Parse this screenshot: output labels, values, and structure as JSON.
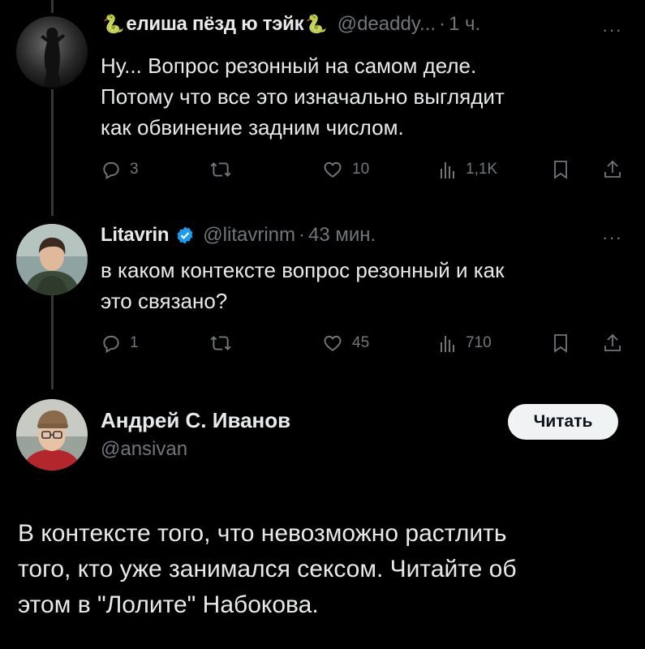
{
  "tweets": [
    {
      "name_before": "елиша пёзд ю тэйк",
      "snake_emoji": "🐍",
      "handle": "@deaddy...",
      "time": "1 ч.",
      "text_lines": [
        "Ну... Вопрос резонный на самом деле.",
        "Потому что все это изначально выглядит",
        "как обвинение задним числом."
      ],
      "replies": "3",
      "retweets": "",
      "likes": "10",
      "views": "1,1K"
    },
    {
      "name": "Litavrin",
      "handle": "@litavrinm",
      "time": "43 мин.",
      "text_lines": [
        "в каком контексте вопрос резонный и как",
        "это связано?"
      ],
      "replies": "1",
      "retweets": "",
      "likes": "45",
      "views": "710"
    }
  ],
  "quote": {
    "name": "Андрей С. Иванов",
    "handle": "@ansivan",
    "follow_label": "Читать",
    "text_lines": [
      "В контексте того, что невозможно растлить",
      "того, кто уже занимался сексом. Читайте об",
      "этом в \"Лолите\" Набокова."
    ]
  },
  "separator": "·",
  "more_label": "···",
  "colors": {
    "background": "#000000",
    "text": "#e7e9ea",
    "muted": "#71767b",
    "verified": "#1d9bf0",
    "button_bg": "#eff3f4"
  }
}
